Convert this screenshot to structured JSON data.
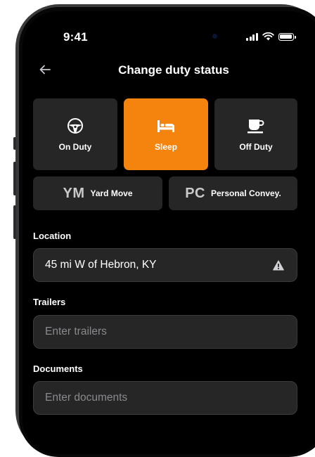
{
  "status_bar": {
    "time": "9:41"
  },
  "header": {
    "title": "Change duty status"
  },
  "duty_options": [
    {
      "label": "On Duty",
      "icon": "steering-wheel-icon",
      "selected": false
    },
    {
      "label": "Sleep",
      "icon": "bed-icon",
      "selected": true
    },
    {
      "label": "Off Duty",
      "icon": "coffee-cup-icon",
      "selected": false
    }
  ],
  "special_options": [
    {
      "abbr": "YM",
      "label": "Yard Move"
    },
    {
      "abbr": "PC",
      "label": "Personal Convey."
    }
  ],
  "form": {
    "location": {
      "label": "Location",
      "value": "45 mi W of Hebron, KY",
      "icon": "warning-icon"
    },
    "trailers": {
      "label": "Trailers",
      "placeholder": "Enter trailers"
    },
    "documents": {
      "label": "Documents",
      "placeholder": "Enter documents"
    }
  },
  "colors": {
    "accent": "#f5840f",
    "tile": "#262626",
    "background": "#000000"
  }
}
